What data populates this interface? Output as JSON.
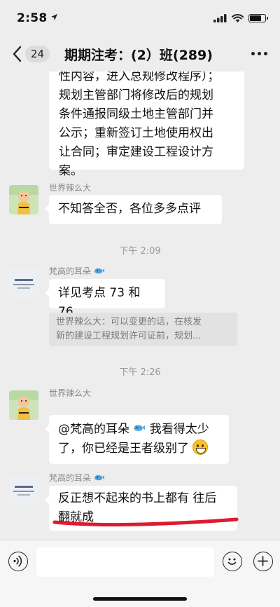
{
  "status": {
    "time": "2:58",
    "battery_level": 0.75
  },
  "nav": {
    "unread_count": "24",
    "title": "期期注考：(2）班(289)"
  },
  "messages": {
    "m0": {
      "lines": [
        "性内容，进入总规修改程序）；",
        "规划主管部门将修改后的规划",
        "条件通报同级土地主管部门并",
        "公示；重新签订土地使用权出",
        "让合同；审定建设工程设计方",
        "案。"
      ]
    },
    "m1": {
      "sender": "世界辣么大",
      "text": "不知答全否，各位多多点评"
    },
    "t1": "下午 2:09",
    "m2": {
      "sender": "梵高的耳朵",
      "text": "详见考点 73 和 76",
      "quote_lines": [
        "世界辣么大：可以变更的话，在核发",
        "新的建设工程规划许可证前，规划..."
      ]
    },
    "t2": "下午 2:26",
    "m3": {
      "sender": "世界辣么大",
      "line1_mention": "@梵高的耳朵",
      "line1_rest": " 我看得太少",
      "line2": "了，你已经是王者级别了"
    },
    "m4": {
      "sender": "梵高的耳朵",
      "line1": "反正想不起来的书上都有 往后",
      "line2": "翻就成"
    }
  },
  "icons": {
    "signal": "signal-bars-icon",
    "wifi": "wifi-icon",
    "battery": "battery-icon",
    "back": "chevron-left-icon",
    "more": "more-dots-icon",
    "whale": "whale-emoji-icon",
    "voice": "voice-input-icon",
    "emoji": "emoji-face-icon",
    "plus": "plus-icon"
  },
  "colors": {
    "background": "#ededed",
    "bubble": "#ffffff",
    "quote_bg": "#e2e2e2",
    "annotation_red": "#e0192f",
    "whale_blue": "#4aa3df"
  }
}
